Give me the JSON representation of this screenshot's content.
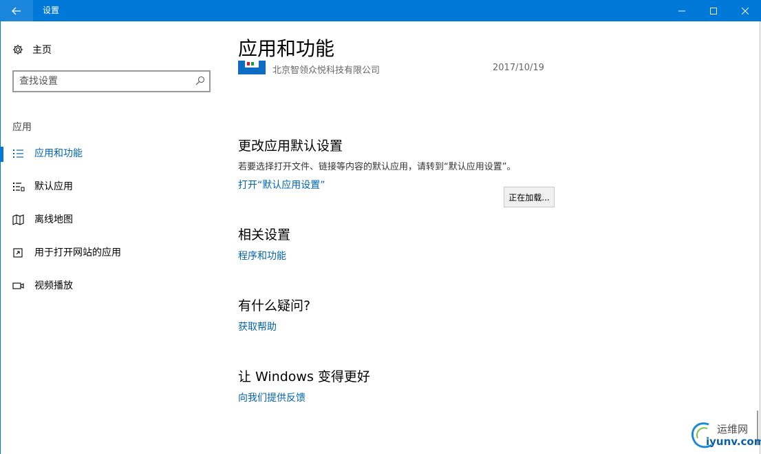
{
  "titlebar": {
    "title": "设置",
    "accent_color": "#0078d7",
    "back_icon": "arrow-left-icon",
    "min_icon": "minimize-icon",
    "max_icon": "maximize-icon",
    "close_icon": "close-icon"
  },
  "sidebar": {
    "home_label": "主页",
    "search_placeholder": "查找设置",
    "section_label": "应用",
    "items": [
      {
        "label": "应用和功能",
        "icon": "list-icon",
        "active": true
      },
      {
        "label": "默认应用",
        "icon": "default-apps-icon",
        "active": false
      },
      {
        "label": "离线地图",
        "icon": "map-icon",
        "active": false
      },
      {
        "label": "用于打开网站的应用",
        "icon": "open-website-icon",
        "active": false
      },
      {
        "label": "视频播放",
        "icon": "video-icon",
        "active": false
      }
    ]
  },
  "main": {
    "title": "应用和功能",
    "app_row": {
      "publisher": "北京智领众悦科技有限公司",
      "date": "2017/10/19"
    },
    "defaults": {
      "heading": "更改应用默认设置",
      "description": "若要选择打开文件、链接等内容的默认应用，请转到“默认应用设置”。",
      "link": "打开“默认应用设置”",
      "loading_button": "正在加载..."
    },
    "related": {
      "heading": "相关设置",
      "link": "程序和功能"
    },
    "questions": {
      "heading": "有什么疑问?",
      "link": "获取帮助"
    },
    "improve": {
      "heading": "让 Windows 变得更好",
      "link": "向我们提供反馈"
    }
  },
  "watermark": {
    "cn": "运维网",
    "en": "iyunv.com"
  },
  "colors": {
    "link": "#0063b1",
    "accent": "#0078d7"
  }
}
